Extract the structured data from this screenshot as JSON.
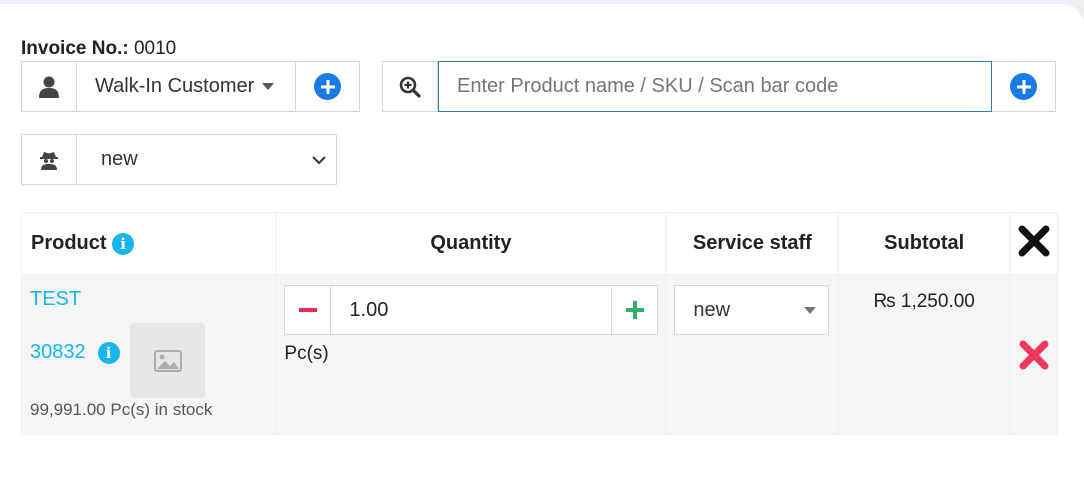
{
  "invoice": {
    "label": "Invoice No.:",
    "number": "0010"
  },
  "customer": {
    "value": "Walk-In Customer",
    "icon": "user-icon"
  },
  "search": {
    "placeholder": "Enter Product name / SKU / Scan bar code",
    "icon": "search-plus-icon"
  },
  "staff_select": {
    "value": "new",
    "icon": "user-secret-icon"
  },
  "table": {
    "headers": {
      "product": "Product",
      "quantity": "Quantity",
      "service_staff": "Service staff",
      "subtotal": "Subtotal"
    },
    "rows": [
      {
        "product_name": "TEST",
        "sku": "30832",
        "stock": "99,991.00 Pc(s) in stock",
        "quantity": "1.00",
        "unit": "Pc(s)",
        "service_staff": "new",
        "subtotal": "₨ 1,250.00"
      }
    ]
  },
  "colors": {
    "accent": "#1a7be6",
    "info": "#17b5ee",
    "minus": "#e0324f",
    "plus": "#2fb56a",
    "remove": "#f2385a"
  }
}
